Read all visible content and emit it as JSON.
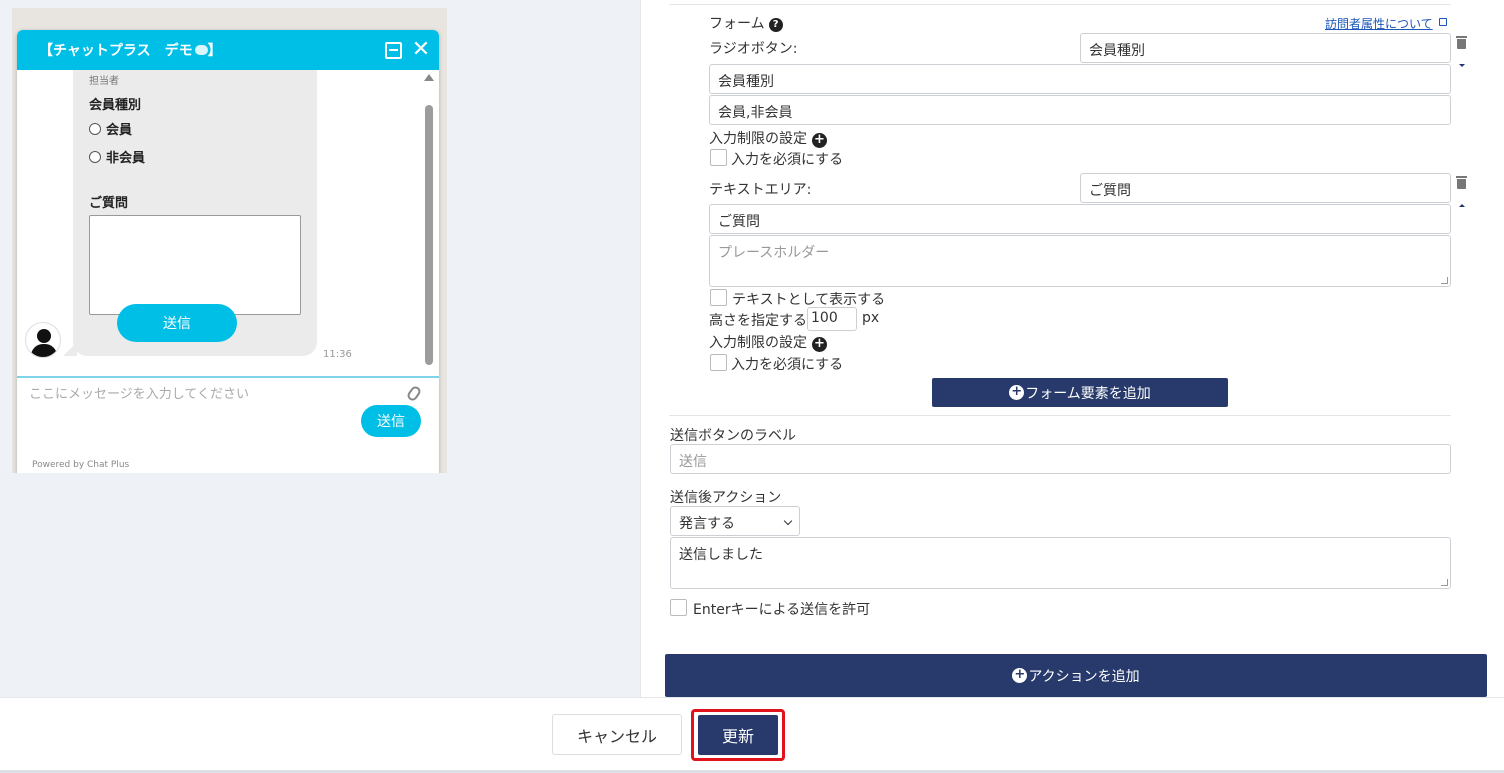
{
  "preview": {
    "header_title": "【チャットプラス　デモ",
    "staff_label": "担当者",
    "field_member_type": "会員種別",
    "radio_options": [
      "会員",
      "非会員"
    ],
    "question_label": "ご質問",
    "bubble_send_label": "送信",
    "message_time": "11:36",
    "input_placeholder": "ここにメッセージを入力してください",
    "send_label": "送信",
    "powered_by": "Powered by Chat Plus",
    "header_bracket_end": "】"
  },
  "form": {
    "section_label": "フォーム",
    "visitor_attr_link": "訪問者属性について",
    "radio": {
      "label": "ラジオボタン:",
      "name_value": "会員種別",
      "title_value": "会員種別",
      "options_value": "会員,非会員",
      "restriction_label": "入力制限の設定",
      "required_label": "入力を必須にする"
    },
    "textarea": {
      "label": "テキストエリア:",
      "name_value": "ご質問",
      "title_value": "ご質問",
      "placeholder": "プレースホルダー",
      "show_as_text_label": "テキストとして表示する",
      "height_label": "高さを指定する",
      "height_value": "100",
      "height_unit": "px",
      "restriction_label": "入力制限の設定",
      "required_label": "入力を必須にする"
    },
    "add_element_label": "フォーム要素を追加",
    "submit_label_title": "送信ボタンのラベル",
    "submit_label_placeholder": "送信",
    "after_action_title": "送信後アクション",
    "after_action_selected": "発言する",
    "after_action_message": "送信しました",
    "enter_key_label": "Enterキーによる送信を許可",
    "add_action_label": "アクションを追加"
  },
  "footer": {
    "cancel_label": "キャンセル",
    "update_label": "更新"
  },
  "colors": {
    "chat_accent": "#00bfe7",
    "navy": "#273a6b",
    "highlight_red": "#e0121b"
  }
}
